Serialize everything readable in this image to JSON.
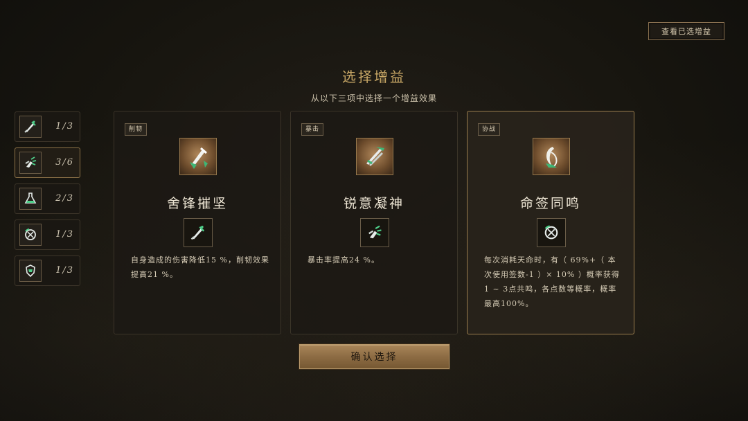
{
  "header": {
    "view_selected_button": "查看已选增益",
    "title": "选择增益",
    "subtitle": "从以下三项中选择一个增益效果"
  },
  "sidebar": {
    "items": [
      {
        "icon": "sword-icon",
        "count": "1/3",
        "active": false
      },
      {
        "icon": "shatter-icon",
        "count": "3/6",
        "active": true
      },
      {
        "icon": "flask-icon",
        "count": "2/3",
        "active": false
      },
      {
        "icon": "rune-circle-icon",
        "count": "1/3",
        "active": false
      },
      {
        "icon": "shield-icon",
        "count": "1/3",
        "active": false
      }
    ]
  },
  "cards": [
    {
      "tag": "削韧",
      "name": "舍锋摧坚",
      "description": "自身造成的伤害降低15 %，削韧效果提高21 %。",
      "big_icon": "greatsword-icon",
      "small_icon": "sword-icon",
      "selected": false
    },
    {
      "tag": "暴击",
      "name": "锐意凝神",
      "description": "暴击率提高24 %。",
      "big_icon": "crossed-blades-icon",
      "small_icon": "shatter-icon",
      "selected": false
    },
    {
      "tag": "协战",
      "name": "命签同鸣",
      "description": "每次消耗天命时，有（ 69%+（ 本次使用签数-1 ）× 10% ）概率获得1 ~ 3点共鸣，各点数等概率，概率最高100%。",
      "big_icon": "crescent-talisman-icon",
      "small_icon": "rune-circle-icon",
      "selected": true
    }
  ],
  "footer": {
    "confirm_button": "确认选择"
  },
  "colors": {
    "accent_gold": "#c9a866",
    "icon_green": "#4fd08a",
    "button_bronze": "#9a7a4f"
  }
}
